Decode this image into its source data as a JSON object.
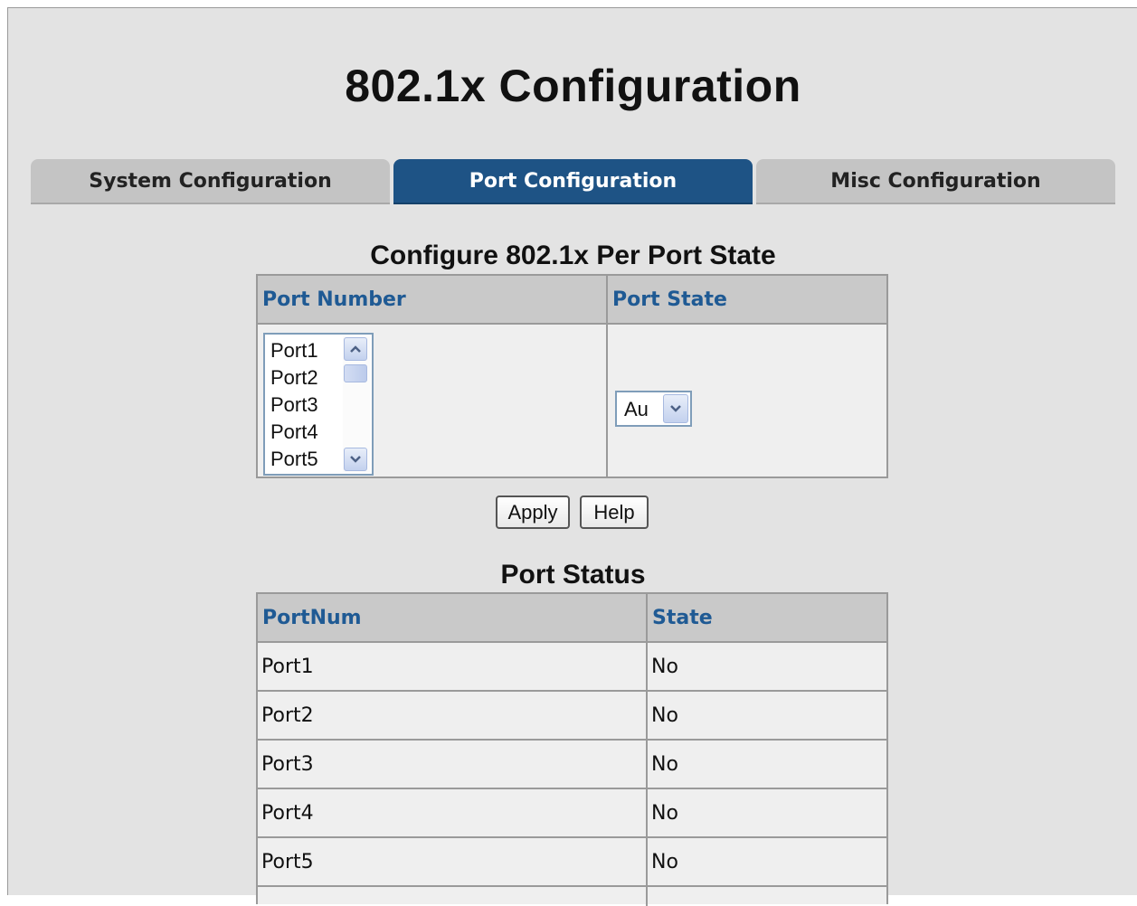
{
  "page": {
    "title": "802.1x Configuration"
  },
  "tabs": [
    {
      "label": "System Configuration",
      "active": false
    },
    {
      "label": "Port Configuration",
      "active": true
    },
    {
      "label": "Misc Configuration",
      "active": false
    }
  ],
  "config": {
    "title": "Configure 802.1x Per Port State",
    "headers": {
      "port_number": "Port Number",
      "port_state": "Port State"
    },
    "port_list": [
      "Port1",
      "Port2",
      "Port3",
      "Port4",
      "Port5"
    ],
    "port_state_selected": "Au",
    "apply_label": "Apply",
    "help_label": "Help"
  },
  "status": {
    "title": "Port Status",
    "headers": {
      "port": "PortNum",
      "state": "State"
    },
    "rows": [
      {
        "port": "Port1",
        "state": "No"
      },
      {
        "port": "Port2",
        "state": "No"
      },
      {
        "port": "Port3",
        "state": "No"
      },
      {
        "port": "Port4",
        "state": "No"
      },
      {
        "port": "Port5",
        "state": "No"
      }
    ]
  },
  "colors": {
    "active_tab": "#1e5385",
    "header_text": "#1f5a94"
  }
}
